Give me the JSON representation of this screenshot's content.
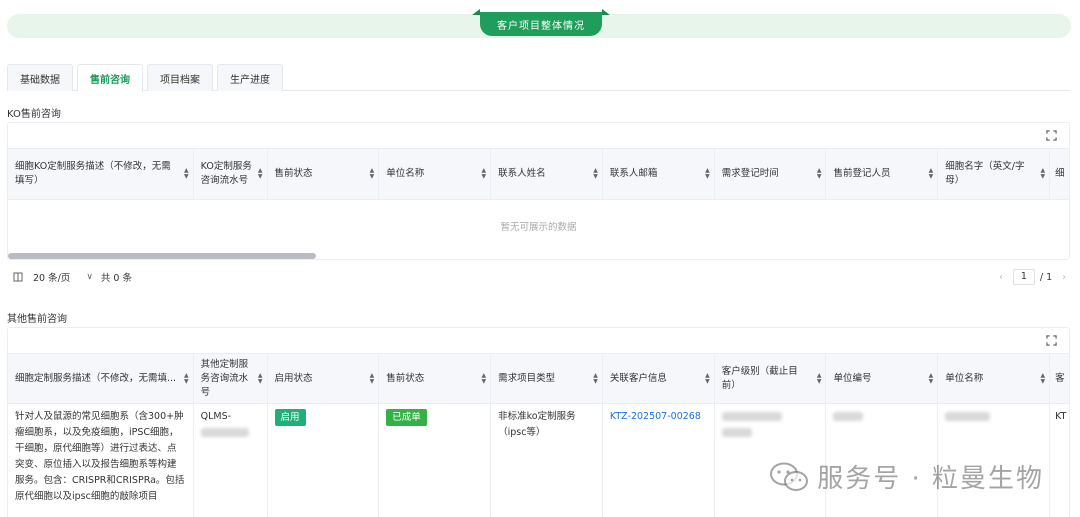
{
  "banner": {
    "title": "客户项目整体情况"
  },
  "tabs": [
    {
      "label": "基础数据",
      "active": false
    },
    {
      "label": "售前咨询",
      "active": true
    },
    {
      "label": "项目档案",
      "active": false
    },
    {
      "label": "生产进度",
      "active": false
    }
  ],
  "ko_section": {
    "title": "KO售前咨询",
    "columns": [
      "细胞KO定制服务描述（不修改，无需填写）",
      "KO定制服务咨询流水号",
      "售前状态",
      "单位名称",
      "联系人姓名",
      "联系人邮箱",
      "需求登记时间",
      "售前登记人员",
      "细胞名字（英文/字母）",
      "细"
    ],
    "empty_text": "暂无可展示的数据",
    "pager": {
      "page_size": "20 条/页",
      "total": "共 0 条",
      "current_page": "1",
      "total_pages": "/ 1"
    }
  },
  "other_section": {
    "title": "其他售前咨询",
    "columns": [
      "细胞定制服务描述（不修改，无需填...",
      "其他定制服务咨询流水号",
      "启用状态",
      "售前状态",
      "需求项目类型",
      "关联客户信息",
      "客户级别（截止目前）",
      "单位编号",
      "单位名称",
      "客"
    ],
    "rows": [
      {
        "description": "针对人及鼠源的常见细胞系（含300+肿瘤细胞系，以及免疫细胞，iPSC细胞，干细胞，原代细胞等）进行过表达、点突变、原位插入以及报告细胞系等构建服务。包含：CRISPR和CRISPRa。包括原代细胞以及ipsc细胞的敲除项目",
        "serial_prefix": "QLMS-",
        "enable_status": "启用",
        "presale_status": "已成单",
        "project_type": "非标准ko定制服务（ipsc等）",
        "customer_link": "KTZ-202507-00268",
        "last_col": "KT"
      }
    ]
  },
  "watermark": "服务号 · 粒曼生物",
  "colors": {
    "accent": "#1f9d5b",
    "banner_bg": "#e7f5ea",
    "tag_green": "#1fb07a",
    "tag_lime": "#33b047",
    "link": "#1a73e8"
  }
}
